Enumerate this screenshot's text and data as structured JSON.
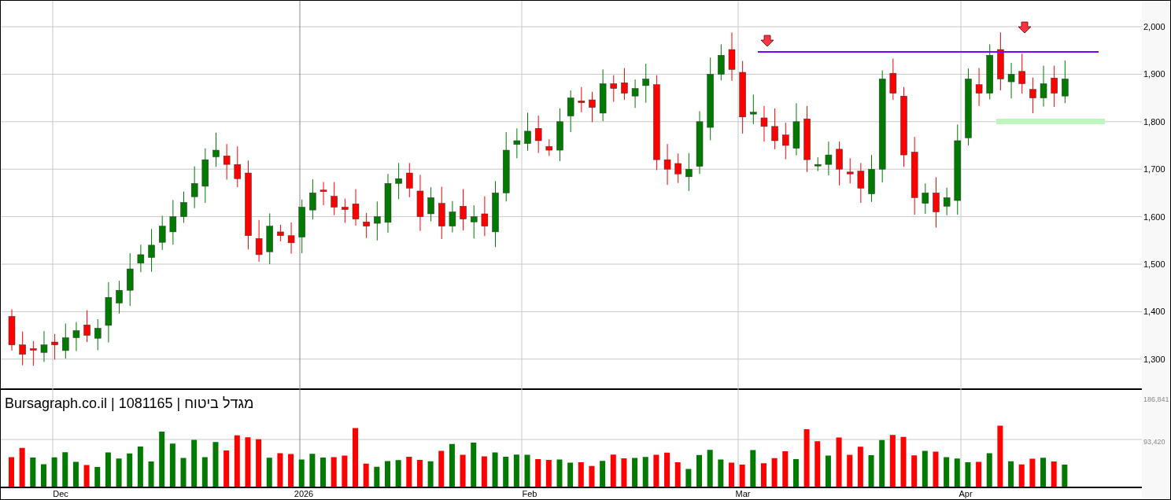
{
  "title": "Bursagraph.co.il | 1081165 | מגדל ביטוח",
  "price_axis": [
    "2,000",
    "1,900",
    "1,800",
    "1,700",
    "1,600",
    "1,500",
    "1,400",
    "1,300"
  ],
  "volume_axis": [
    "186,841",
    "93,420"
  ],
  "time_axis": [
    "Dec",
    "2026",
    "Feb",
    "Mar",
    "Apr"
  ]
}
